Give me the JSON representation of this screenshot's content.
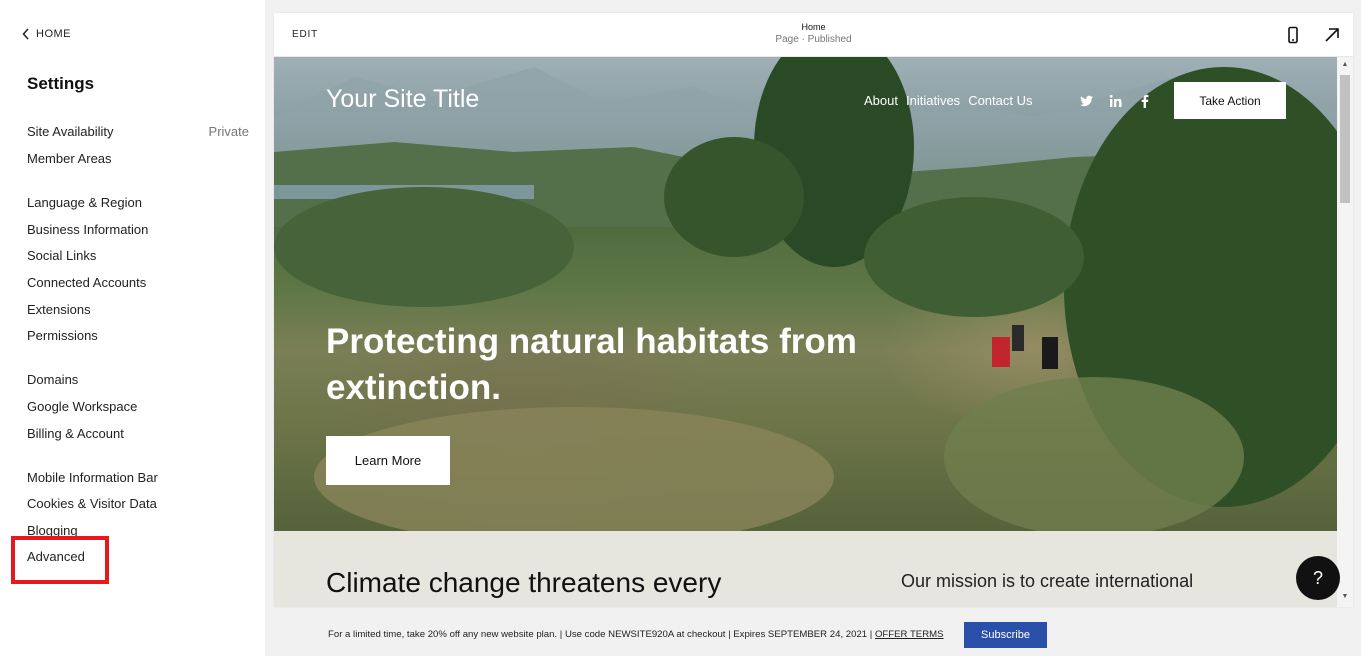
{
  "sidebar": {
    "back_label": "HOME",
    "title": "Settings",
    "items": [
      {
        "label": "Site Availability",
        "value": "Private"
      },
      {
        "label": "Member Areas",
        "value": ""
      },
      {
        "label": "Language & Region",
        "value": ""
      },
      {
        "label": "Business Information",
        "value": ""
      },
      {
        "label": "Social Links",
        "value": ""
      },
      {
        "label": "Connected Accounts",
        "value": ""
      },
      {
        "label": "Extensions",
        "value": ""
      },
      {
        "label": "Permissions",
        "value": ""
      },
      {
        "label": "Domains",
        "value": ""
      },
      {
        "label": "Google Workspace",
        "value": ""
      },
      {
        "label": "Billing & Account",
        "value": ""
      },
      {
        "label": "Mobile Information Bar",
        "value": ""
      },
      {
        "label": "Cookies & Visitor Data",
        "value": ""
      },
      {
        "label": "Blogging",
        "value": ""
      },
      {
        "label": "Advanced",
        "value": ""
      }
    ],
    "highlight_color": "#e8191c"
  },
  "preview": {
    "edit_label": "EDIT",
    "page_name": "Home",
    "page_status": "Page · Published",
    "icons": [
      "mobile-view-icon",
      "expand-arrow-icon"
    ]
  },
  "site": {
    "title": "Your Site Title",
    "nav": [
      "About",
      "Initiatives",
      "Contact Us"
    ],
    "social_icons": [
      "twitter-icon",
      "linkedin-icon",
      "facebook-icon"
    ],
    "cta_label": "Take Action",
    "hero_heading": "Protecting natural habitats from extinction.",
    "hero_button": "Learn More",
    "section_heading": "Climate change threatens every",
    "section_mission": "Our mission is to create international"
  },
  "help": {
    "label": "?"
  },
  "promo": {
    "text": "For a limited time, take 20% off any new website plan. | Use code NEWSITE920A at checkout | Expires SEPTEMBER 24, 2021 | ",
    "offer_terms": "OFFER TERMS",
    "subscribe_label": "Subscribe",
    "subscribe_color": "#2a4fa8"
  }
}
